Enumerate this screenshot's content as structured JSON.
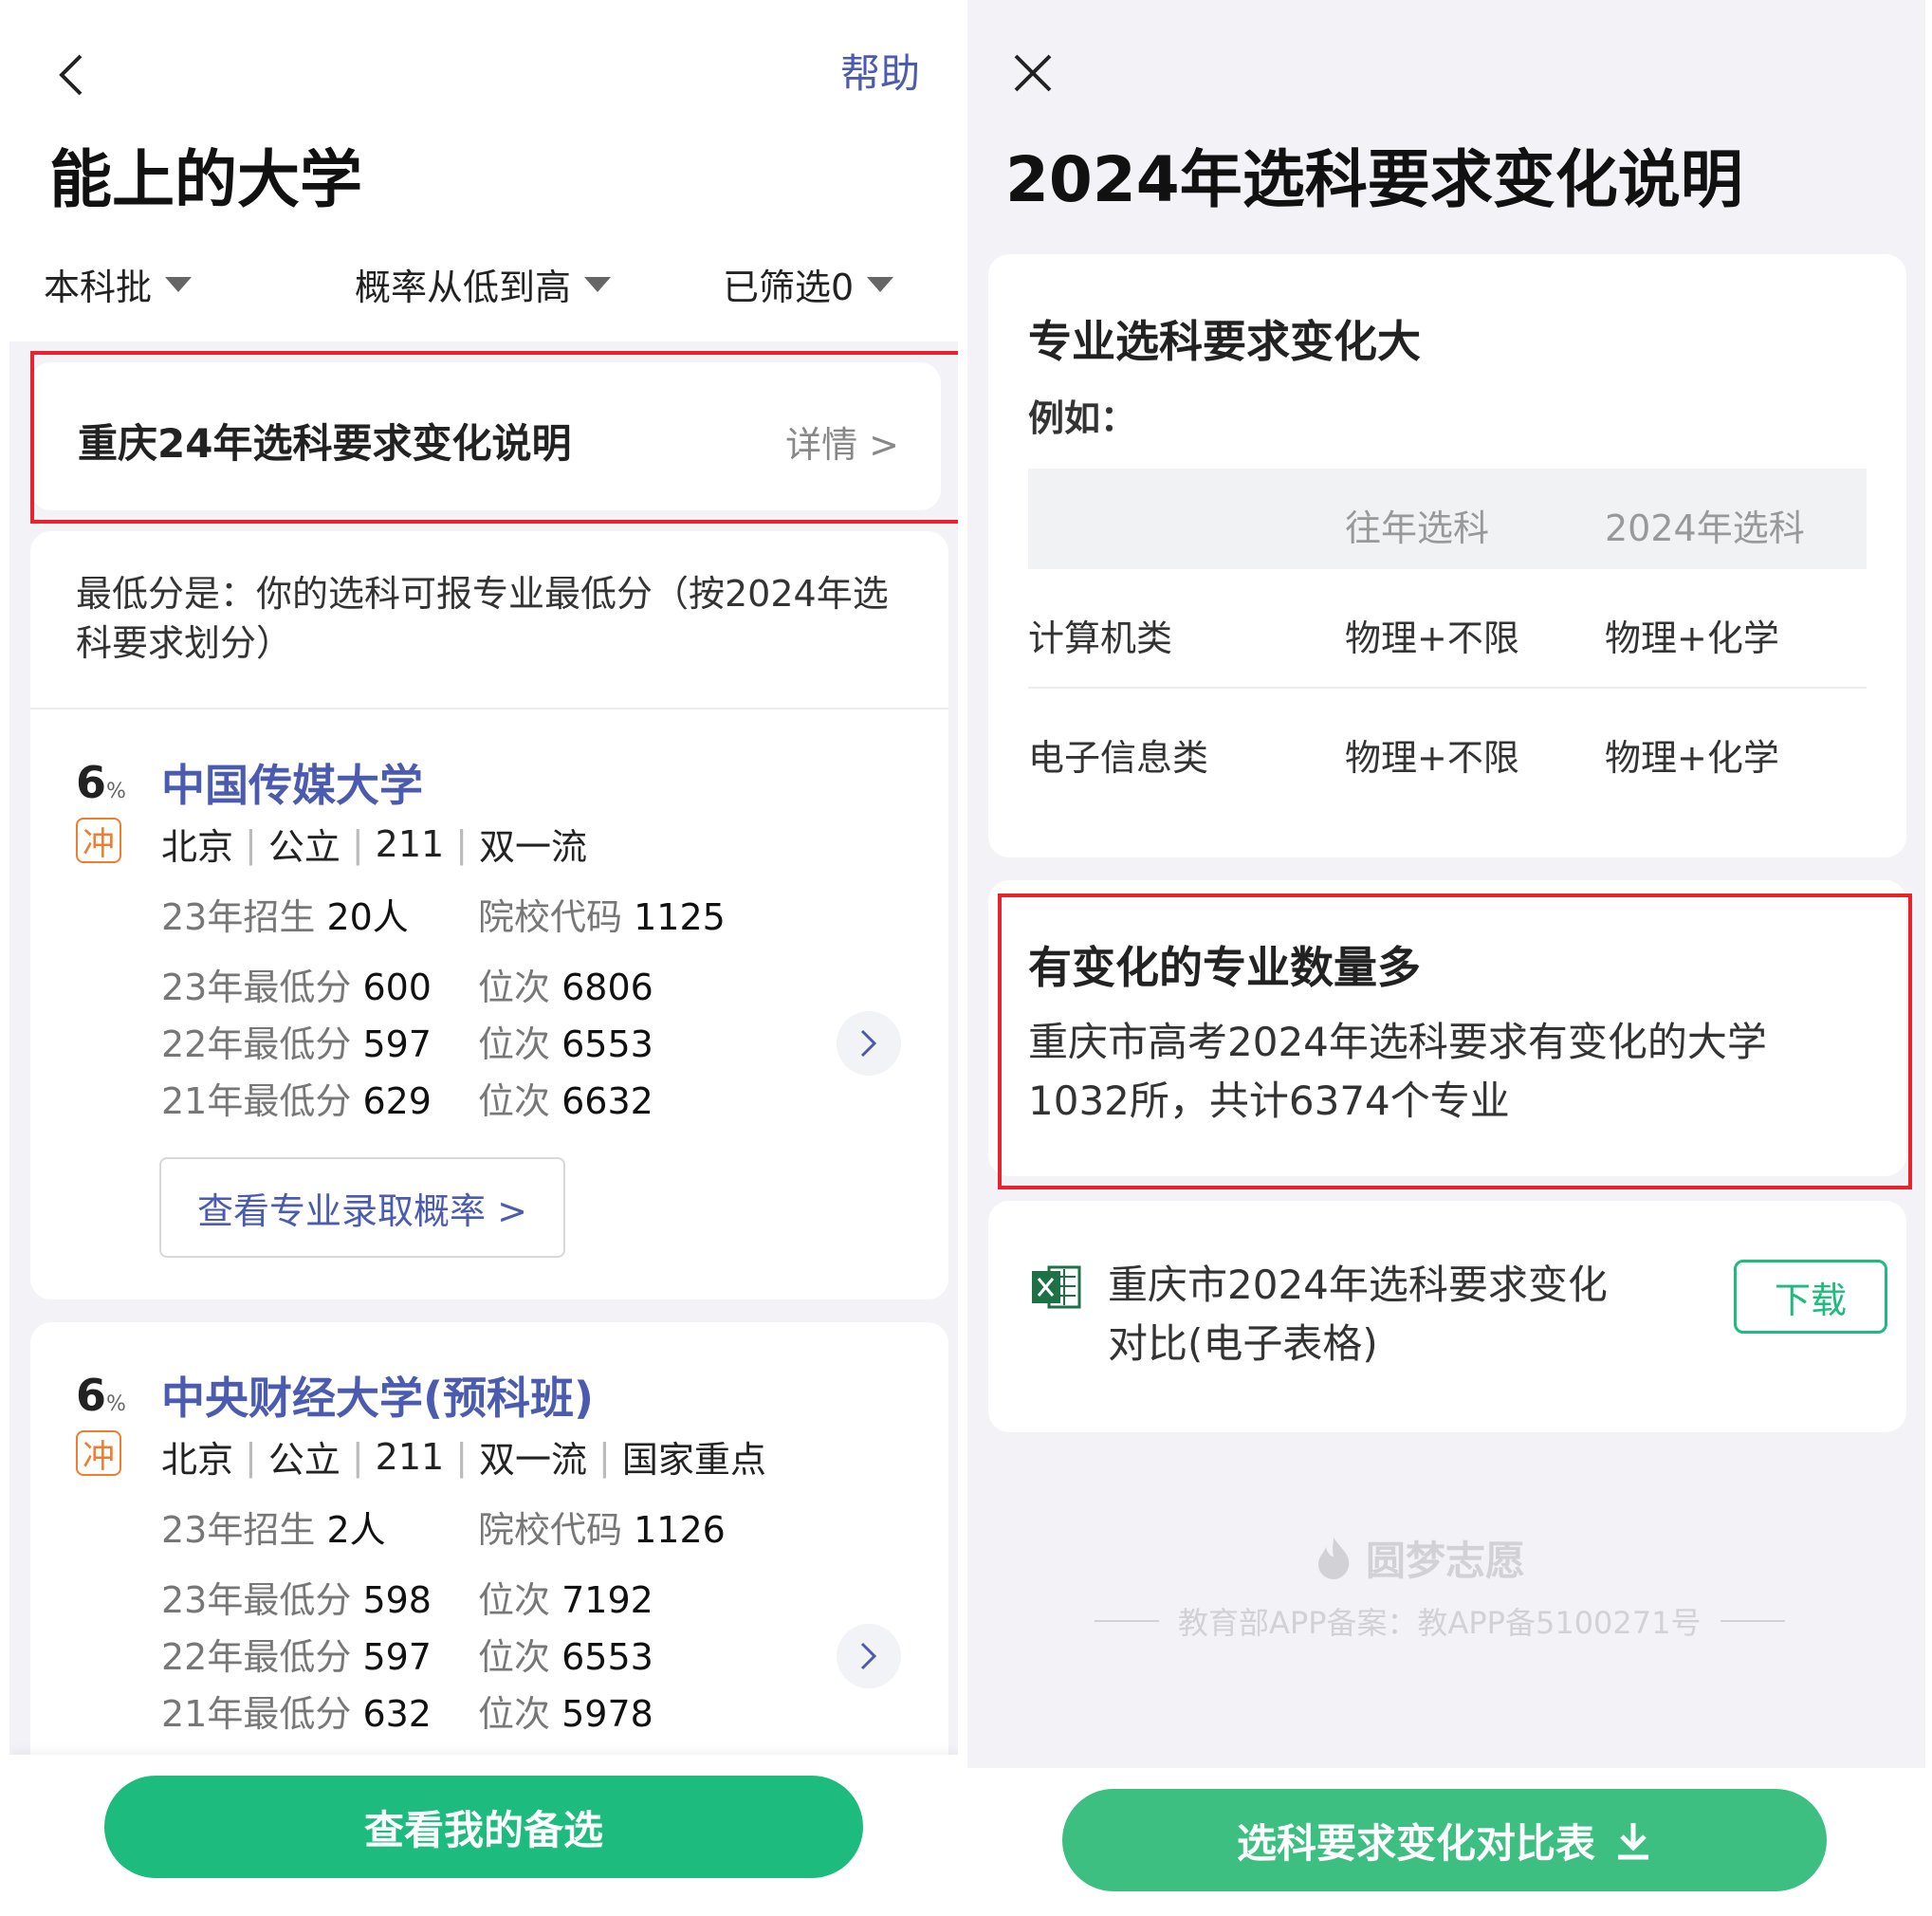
{
  "left": {
    "header": {
      "help": "帮助",
      "title": "能上的大学"
    },
    "filters": [
      {
        "label": "本科批"
      },
      {
        "label": "概率从低到高"
      },
      {
        "label": "已筛选0"
      }
    ],
    "notice": {
      "title": "重庆24年选科要求变化说明",
      "link": "详情 >"
    },
    "note": "最低分是：你的选科可报专业最低分（按2024年选科要求划分）",
    "universities": [
      {
        "percent": "6",
        "percent_unit": "%",
        "badge": "冲",
        "name": "中国传媒大学",
        "tags": [
          "北京",
          "公立",
          "211",
          "双一流"
        ],
        "enroll_label": "23年招生",
        "enroll_value": "20人",
        "code_label": "院校代码",
        "code_value": "1125",
        "scores": [
          {
            "year_label": "23年最低分",
            "score": "600",
            "rank_label": "位次",
            "rank": "6806"
          },
          {
            "year_label": "22年最低分",
            "score": "597",
            "rank_label": "位次",
            "rank": "6553"
          },
          {
            "year_label": "21年最低分",
            "score": "629",
            "rank_label": "位次",
            "rank": "6632"
          }
        ],
        "action": "查看专业录取概率 >"
      },
      {
        "percent": "6",
        "percent_unit": "%",
        "badge": "冲",
        "name": "中央财经大学(预科班)",
        "tags": [
          "北京",
          "公立",
          "211",
          "双一流",
          "国家重点"
        ],
        "enroll_label": "23年招生",
        "enroll_value": "2人",
        "code_label": "院校代码",
        "code_value": "1126",
        "scores": [
          {
            "year_label": "23年最低分",
            "score": "598",
            "rank_label": "位次",
            "rank": "7192"
          },
          {
            "year_label": "22年最低分",
            "score": "597",
            "rank_label": "位次",
            "rank": "6553"
          },
          {
            "year_label": "21年最低分",
            "score": "632",
            "rank_label": "位次",
            "rank": "5978"
          }
        ]
      }
    ],
    "bottom_button": "查看我的备选"
  },
  "right": {
    "title": "2024年选科要求变化说明",
    "section1": {
      "title": "专业选科要求变化大",
      "subtitle": "例如：",
      "table": {
        "headers": [
          "",
          "往年选科",
          "2024年选科"
        ],
        "rows": [
          [
            "计算机类",
            "物理+不限",
            "物理+化学"
          ],
          [
            "电子信息类",
            "物理+不限",
            "物理+化学"
          ]
        ]
      }
    },
    "section2": {
      "title": "有变化的专业数量多",
      "text": "重庆市高考2024年选科要求有变化的大学1032所，共计6374个专业"
    },
    "file": {
      "icon": "excel-icon",
      "name": "重庆市2024年选科要求变化对比(电子表格)",
      "download": "下载"
    },
    "watermark": {
      "brand": "圆梦志愿",
      "record": "教育部APP备案：教APP备5100271号"
    },
    "bottom_button": "选科要求变化对比表"
  },
  "colors": {
    "accent_green": "#1dbb7d",
    "link_blue": "#4a5bb0",
    "highlight_red": "#e8232b",
    "badge_orange": "#f07c2e",
    "background_gray": "#f3f2f7"
  }
}
